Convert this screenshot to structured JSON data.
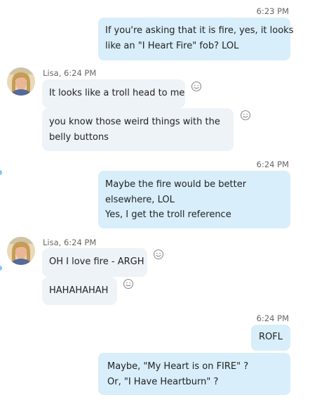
{
  "messages": [
    {
      "time": "6:23 PM",
      "lines": [
        "If you're asking that it is fire, yes, it looks",
        "like an  \"I Heart Fire\" fob? LOL"
      ]
    },
    {
      "sender": "Lisa, 6:24 PM",
      "bubbles": [
        [
          "It looks like a troll head to me"
        ],
        [
          "you know those weird things with the",
          "belly buttons"
        ]
      ]
    },
    {
      "time": "6:24 PM",
      "lines": [
        "Maybe the fire would be better",
        "elsewhere, LOL",
        "Yes, I get the troll reference"
      ]
    },
    {
      "sender": "Lisa, 6:24 PM",
      "bubbles": [
        [
          "OH I love fire - ARGH"
        ],
        [
          "HAHAHAHAH"
        ]
      ]
    },
    {
      "time": "6:24 PM",
      "bubbles": [
        [
          "ROFL"
        ],
        [
          "Maybe, \"My Heart is on FIRE\" ?",
          "Or, \"I Have Heartburn\" ?"
        ]
      ]
    }
  ],
  "icons": {
    "avatar": "contact-avatar",
    "reaction": "smiley-icon"
  },
  "colors": {
    "outgoing_bubble": "#d8eefa",
    "incoming_bubble": "#eef3f8",
    "timestamp": "#666666",
    "text": "#222222",
    "edge_mark": "#7ac7f0"
  }
}
